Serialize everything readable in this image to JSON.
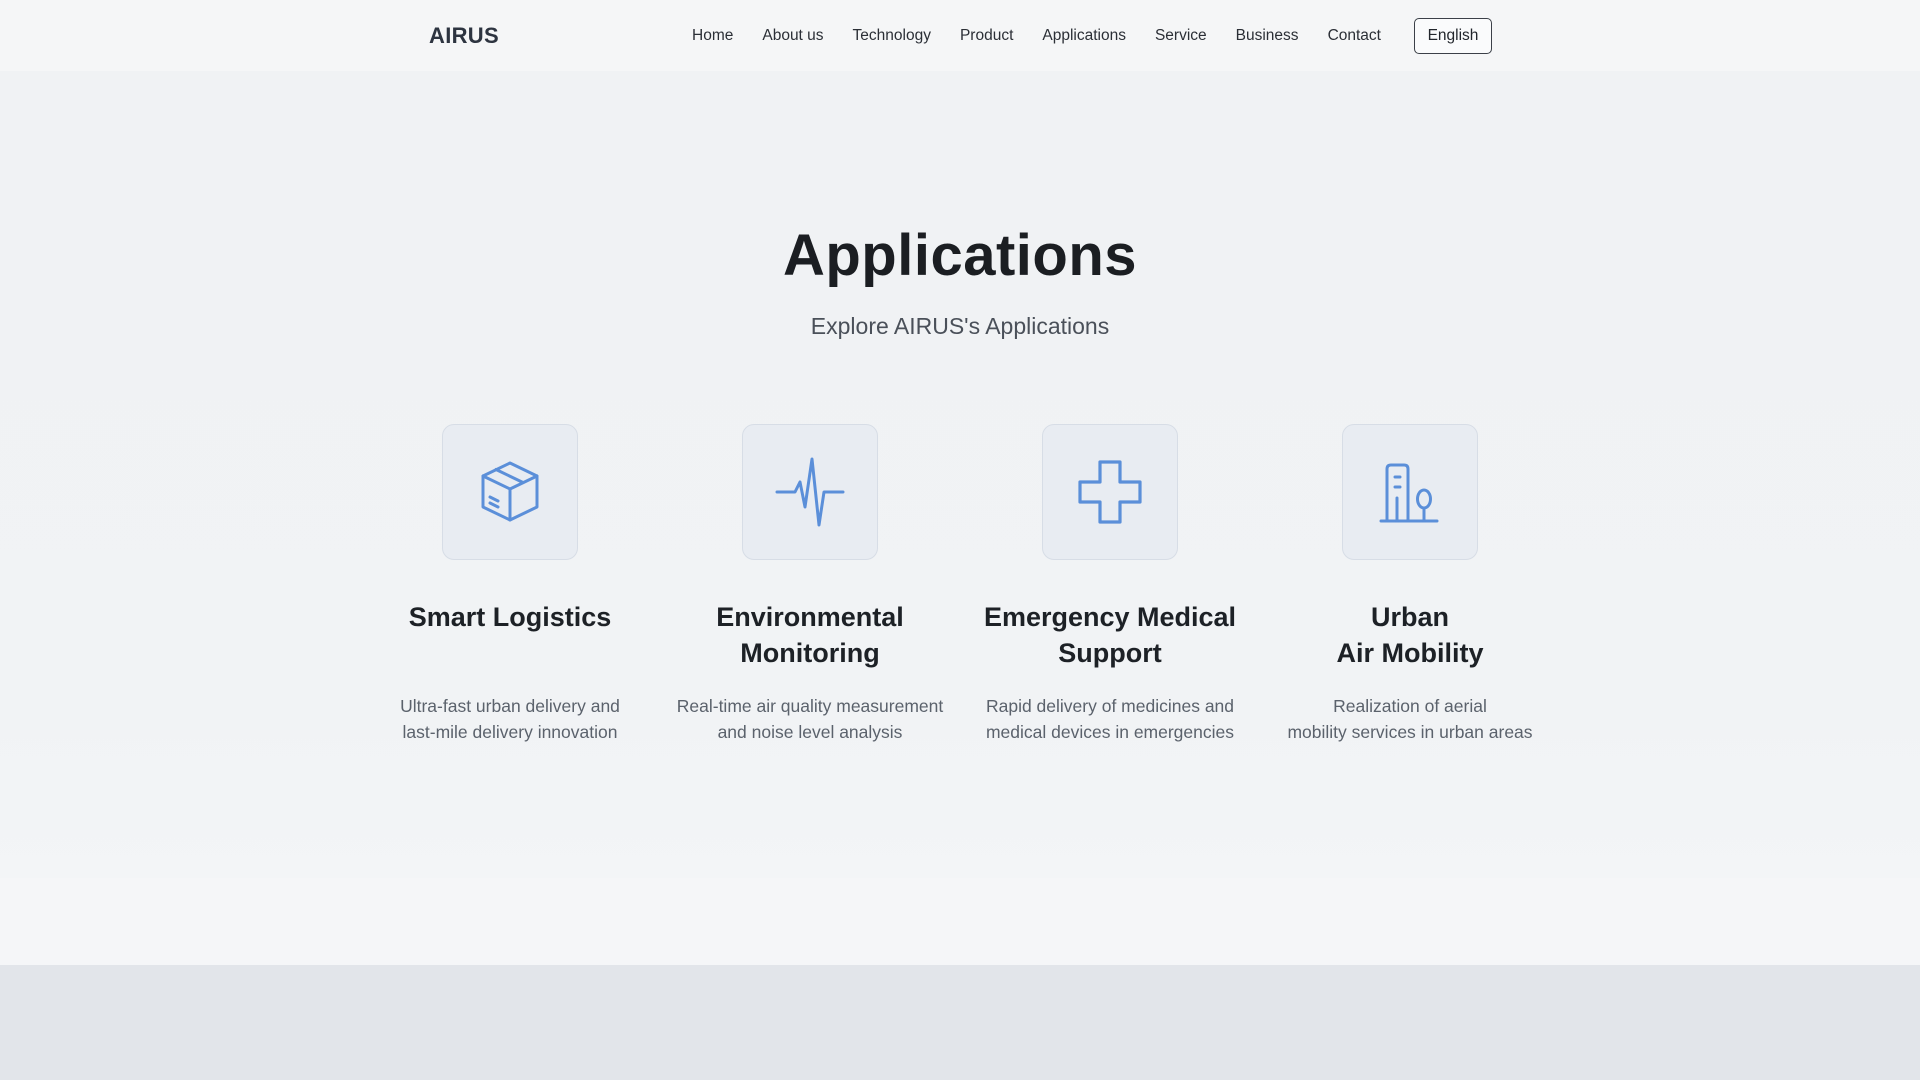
{
  "header": {
    "logo": "AIRUS",
    "nav": [
      "Home",
      "About us",
      "Technology",
      "Product",
      "Applications",
      "Service",
      "Business",
      "Contact"
    ],
    "language": "English"
  },
  "hero": {
    "title": "Applications",
    "subtitle": "Explore AIRUS's Applications"
  },
  "cards": [
    {
      "icon": "package-box-icon",
      "title_line1": "Smart Logistics",
      "title_line2": "",
      "desc_line1": "Ultra-fast urban delivery and",
      "desc_line2": "last-mile delivery innovation"
    },
    {
      "icon": "activity-pulse-icon",
      "title_line1": "Environmental",
      "title_line2": "Monitoring",
      "desc_line1": "Real-time air quality measurement",
      "desc_line2": "and noise level analysis"
    },
    {
      "icon": "medical-cross-icon",
      "title_line1": "Emergency Medical",
      "title_line2": "Support",
      "desc_line1": "Rapid delivery of medicines and",
      "desc_line2": "medical devices in emergencies"
    },
    {
      "icon": "city-building-icon",
      "title_line1": "Urban",
      "title_line2": "Air Mobility",
      "desc_line1": "Realization of aerial",
      "desc_line2": "mobility services in urban areas"
    }
  ],
  "colors": {
    "accent_icon": "#5b8fd9",
    "page_background": "#f0f2f4",
    "text_primary": "#1b1e22"
  }
}
